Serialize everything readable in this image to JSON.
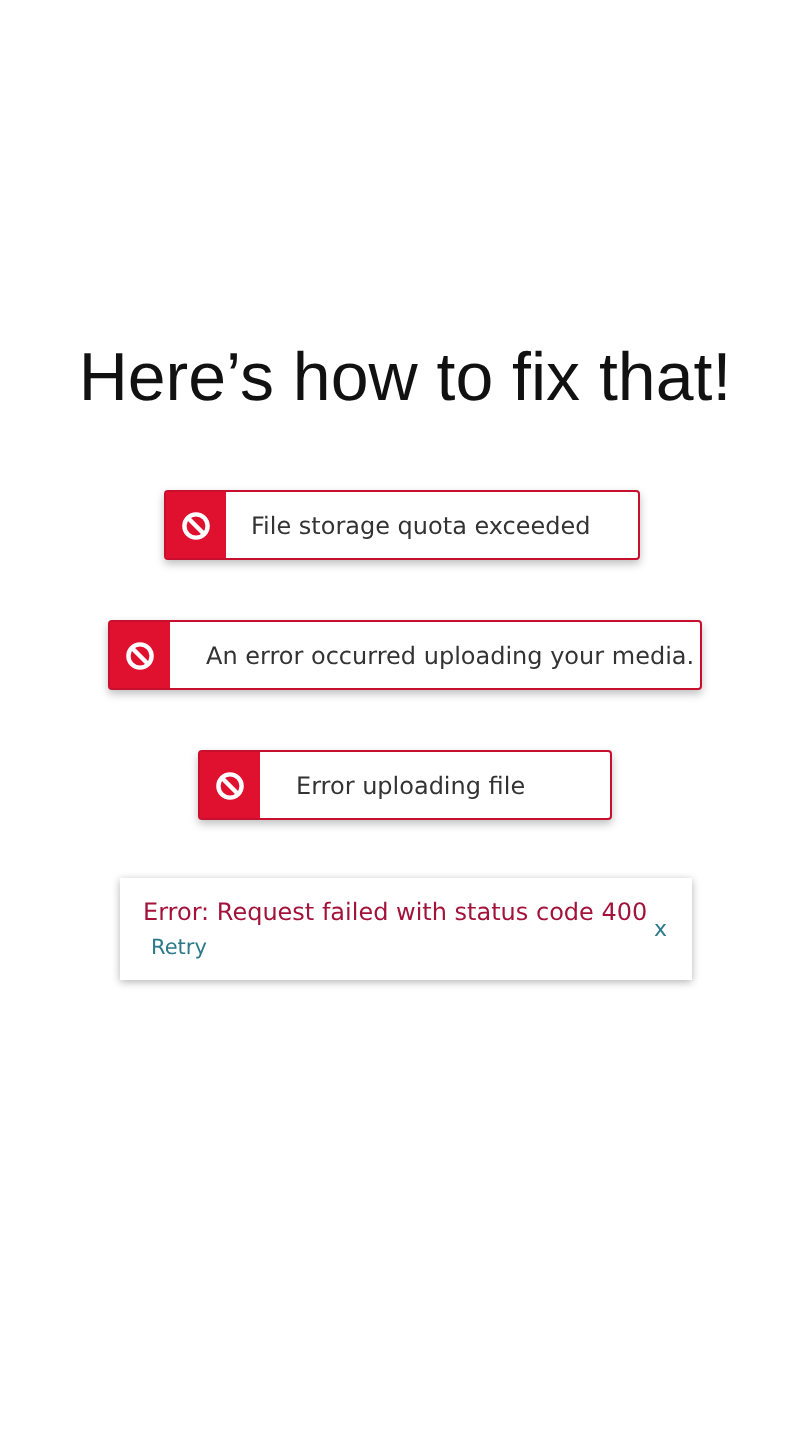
{
  "heading": "Here’s how to fix that!",
  "alerts": [
    {
      "message": "File storage quota exceeded"
    },
    {
      "message": "An error occurred uploading your media."
    },
    {
      "message": "Error uploading file"
    }
  ],
  "error_card": {
    "message": "Error: Request failed with status code 400",
    "action": "Retry",
    "close": "x"
  }
}
